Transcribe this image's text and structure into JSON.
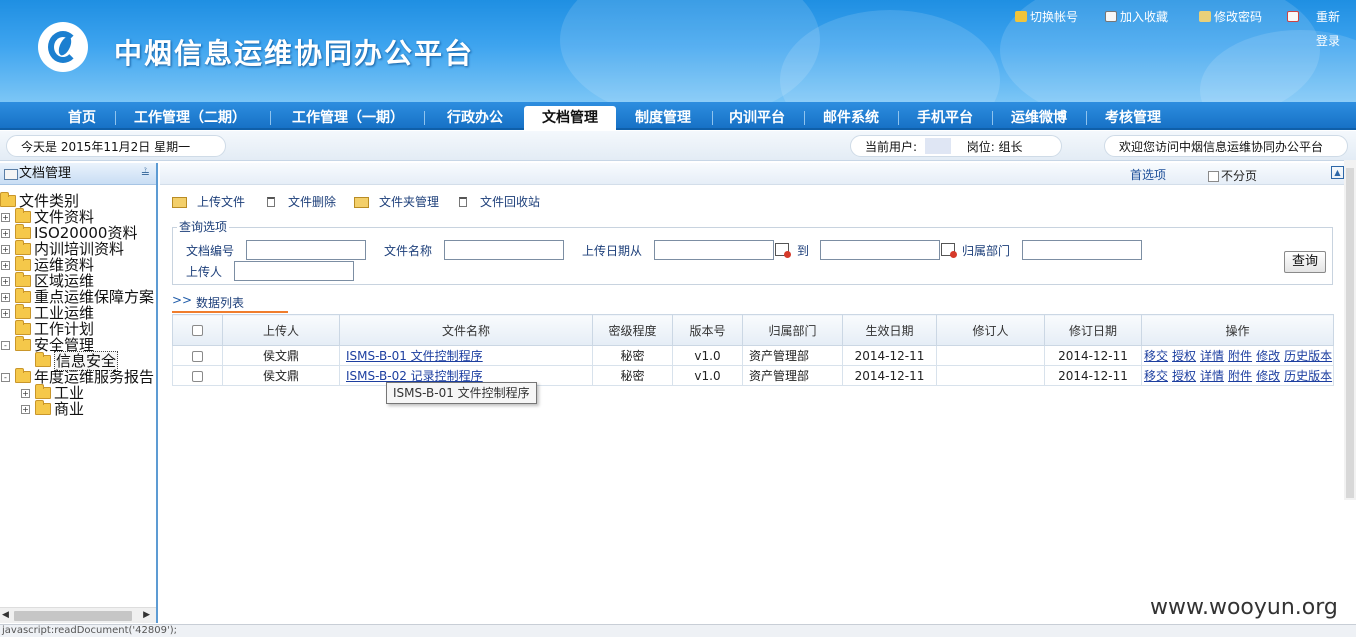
{
  "header": {
    "title": "中烟信息运维协同办公平台",
    "links": [
      "切换帐号",
      "加入收藏",
      "修改密码",
      "重新",
      "登录"
    ]
  },
  "nav": [
    "首页",
    "工作管理（二期）",
    "工作管理（一期）",
    "行政办公",
    "文档管理",
    "制度管理",
    "内训平台",
    "邮件系统",
    "手机平台",
    "运维微博",
    "考核管理"
  ],
  "nav_active": "文档管理",
  "infobar": {
    "date_text": "今天是 2015年11月2日 星期一",
    "user_label": "当前用户:",
    "position_text": "岗位: 组长",
    "welcome": "欢迎您访问中烟信息运维协同办公平台"
  },
  "sidebar": {
    "title": "文档管理",
    "tree": {
      "root": "文件类别",
      "items": [
        "文件资料",
        "ISO20000资料",
        "内训培训资料",
        "运维资料",
        "区域运维",
        "重点运维保障方案",
        "工业运维",
        "工作计划",
        "安全管理",
        "信息安全",
        "年度运维服务报告",
        "工业",
        "商业"
      ]
    }
  },
  "main": {
    "home_link": "首选项",
    "no_paging": "不分页",
    "toolbar": [
      "上传文件",
      "文件删除",
      "文件夹管理",
      "文件回收站"
    ],
    "query": {
      "legend": "查询选项",
      "labels": [
        "文档编号",
        "文件名称",
        "上传日期从",
        "到",
        "归属部门",
        "上传人"
      ],
      "button": "查询"
    },
    "list_tab": "数据列表",
    "table": {
      "headers": [
        "上传人",
        "文件名称",
        "密级程度",
        "版本号",
        "归属部门",
        "生效日期",
        "修订人",
        "修订日期",
        "操作"
      ],
      "rows": [
        {
          "uploader": "侯文鼎",
          "name": "ISMS-B-01 文件控制程序",
          "level": "秘密",
          "version": "v1.0",
          "dept": "资产管理部",
          "effective": "2014-12-11",
          "reviser": "",
          "revised": "2014-12-11"
        },
        {
          "uploader": "侯文鼎",
          "name": "ISMS-B-02 记录控制程序",
          "level": "秘密",
          "version": "v1.0",
          "dept": "资产管理部",
          "effective": "2014-12-11",
          "reviser": "",
          "revised": "2014-12-11"
        }
      ],
      "ops": [
        "移交",
        "授权",
        "详情",
        "附件",
        "修改",
        "历史版本"
      ]
    },
    "tooltip": "ISMS-B-01 文件控制程序"
  },
  "watermark": "www.wooyun.org",
  "status_text": "javascript:readDocument('42809');",
  "colors": {
    "header_blue": "#2d8ee0",
    "accent_orange": "#f07d2c",
    "link_blue": "#1d3fa0"
  }
}
